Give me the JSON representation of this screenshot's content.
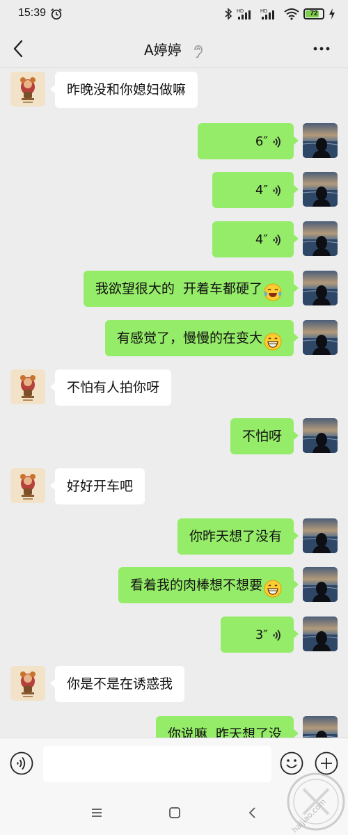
{
  "status_bar": {
    "time": "15:39",
    "network_1": "HD",
    "network_2": "HD",
    "battery": "72",
    "battery_level": 0.72
  },
  "header": {
    "title": "A婷婷"
  },
  "messages": [
    {
      "side": "left",
      "type": "text",
      "text": "昨晚没和你媳妇做嘛"
    },
    {
      "side": "right",
      "type": "voice",
      "duration": "6″"
    },
    {
      "side": "right",
      "type": "voice",
      "duration": "4″"
    },
    {
      "side": "right",
      "type": "voice",
      "duration": "4″"
    },
    {
      "side": "right",
      "type": "text",
      "text": "我欲望很大的  开着车都硬了",
      "emoji": "crying-laughing"
    },
    {
      "side": "right",
      "type": "text",
      "text": "有感觉了，慢慢的在变大",
      "emoji": "grinning"
    },
    {
      "side": "left",
      "type": "text",
      "text": "不怕有人拍你呀"
    },
    {
      "side": "right",
      "type": "text",
      "text": "不怕呀"
    },
    {
      "side": "left",
      "type": "text",
      "text": "好好开车吧"
    },
    {
      "side": "right",
      "type": "text",
      "text": "你昨天想了没有"
    },
    {
      "side": "right",
      "type": "text",
      "text": "看着我的肉棒想不想要",
      "emoji": "grinning"
    },
    {
      "side": "right",
      "type": "voice",
      "duration": "3″"
    },
    {
      "side": "left",
      "type": "text",
      "text": "你是不是在诱惑我"
    },
    {
      "side": "right",
      "type": "text",
      "text": "你说嘛  昨天想了没"
    }
  ],
  "input": {
    "value": ""
  },
  "watermark": {
    "text": "haijiao.com"
  },
  "colors": {
    "background": "#ededed",
    "my_bubble": "#95ec69",
    "their_bubble": "#ffffff",
    "battery_fill": "#7cd04a"
  }
}
